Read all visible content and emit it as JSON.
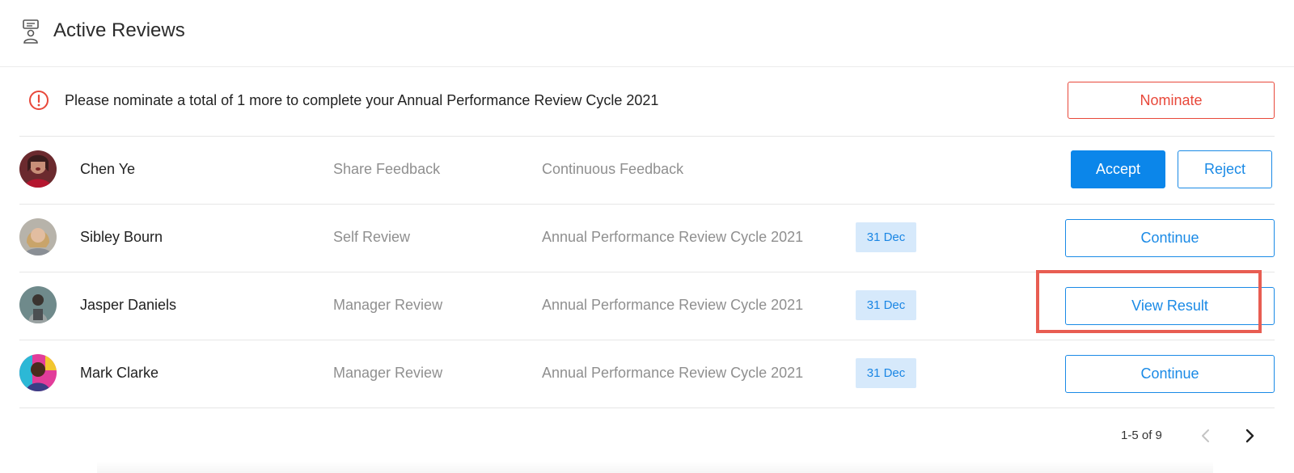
{
  "header": {
    "title": "Active Reviews",
    "icon": "review-board-icon"
  },
  "notice": {
    "message": "Please nominate a total of 1 more to complete your Annual Performance Review Cycle 2021",
    "action_label": "Nominate",
    "icon": "alert-circle-icon",
    "accent": "#e8483a"
  },
  "reviews": [
    {
      "name": "Chen Ye",
      "type": "Share Feedback",
      "cycle": "Continuous Feedback",
      "date": "",
      "accept_label": "Accept",
      "reject_label": "Reject"
    },
    {
      "name": "Sibley Bourn",
      "type": "Self Review",
      "cycle": "Annual Performance Review Cycle 2021",
      "date": "31 Dec",
      "action_label": "Continue"
    },
    {
      "name": "Jasper Daniels",
      "type": "Manager Review",
      "cycle": "Annual Performance Review Cycle 2021",
      "date": "31 Dec",
      "action_label": "View Result"
    },
    {
      "name": "Mark Clarke",
      "type": "Manager Review",
      "cycle": "Annual Performance Review Cycle 2021",
      "date": "31 Dec",
      "action_label": "Continue"
    }
  ],
  "pagination": {
    "range_text": "1-5 of 9",
    "prev_icon": "chevron-left-icon",
    "next_icon": "chevron-right-icon"
  },
  "colors": {
    "primary": "#0b86ea",
    "danger": "#e8483a",
    "highlight": "#e85d52",
    "date_bg": "#d6e9fb"
  }
}
